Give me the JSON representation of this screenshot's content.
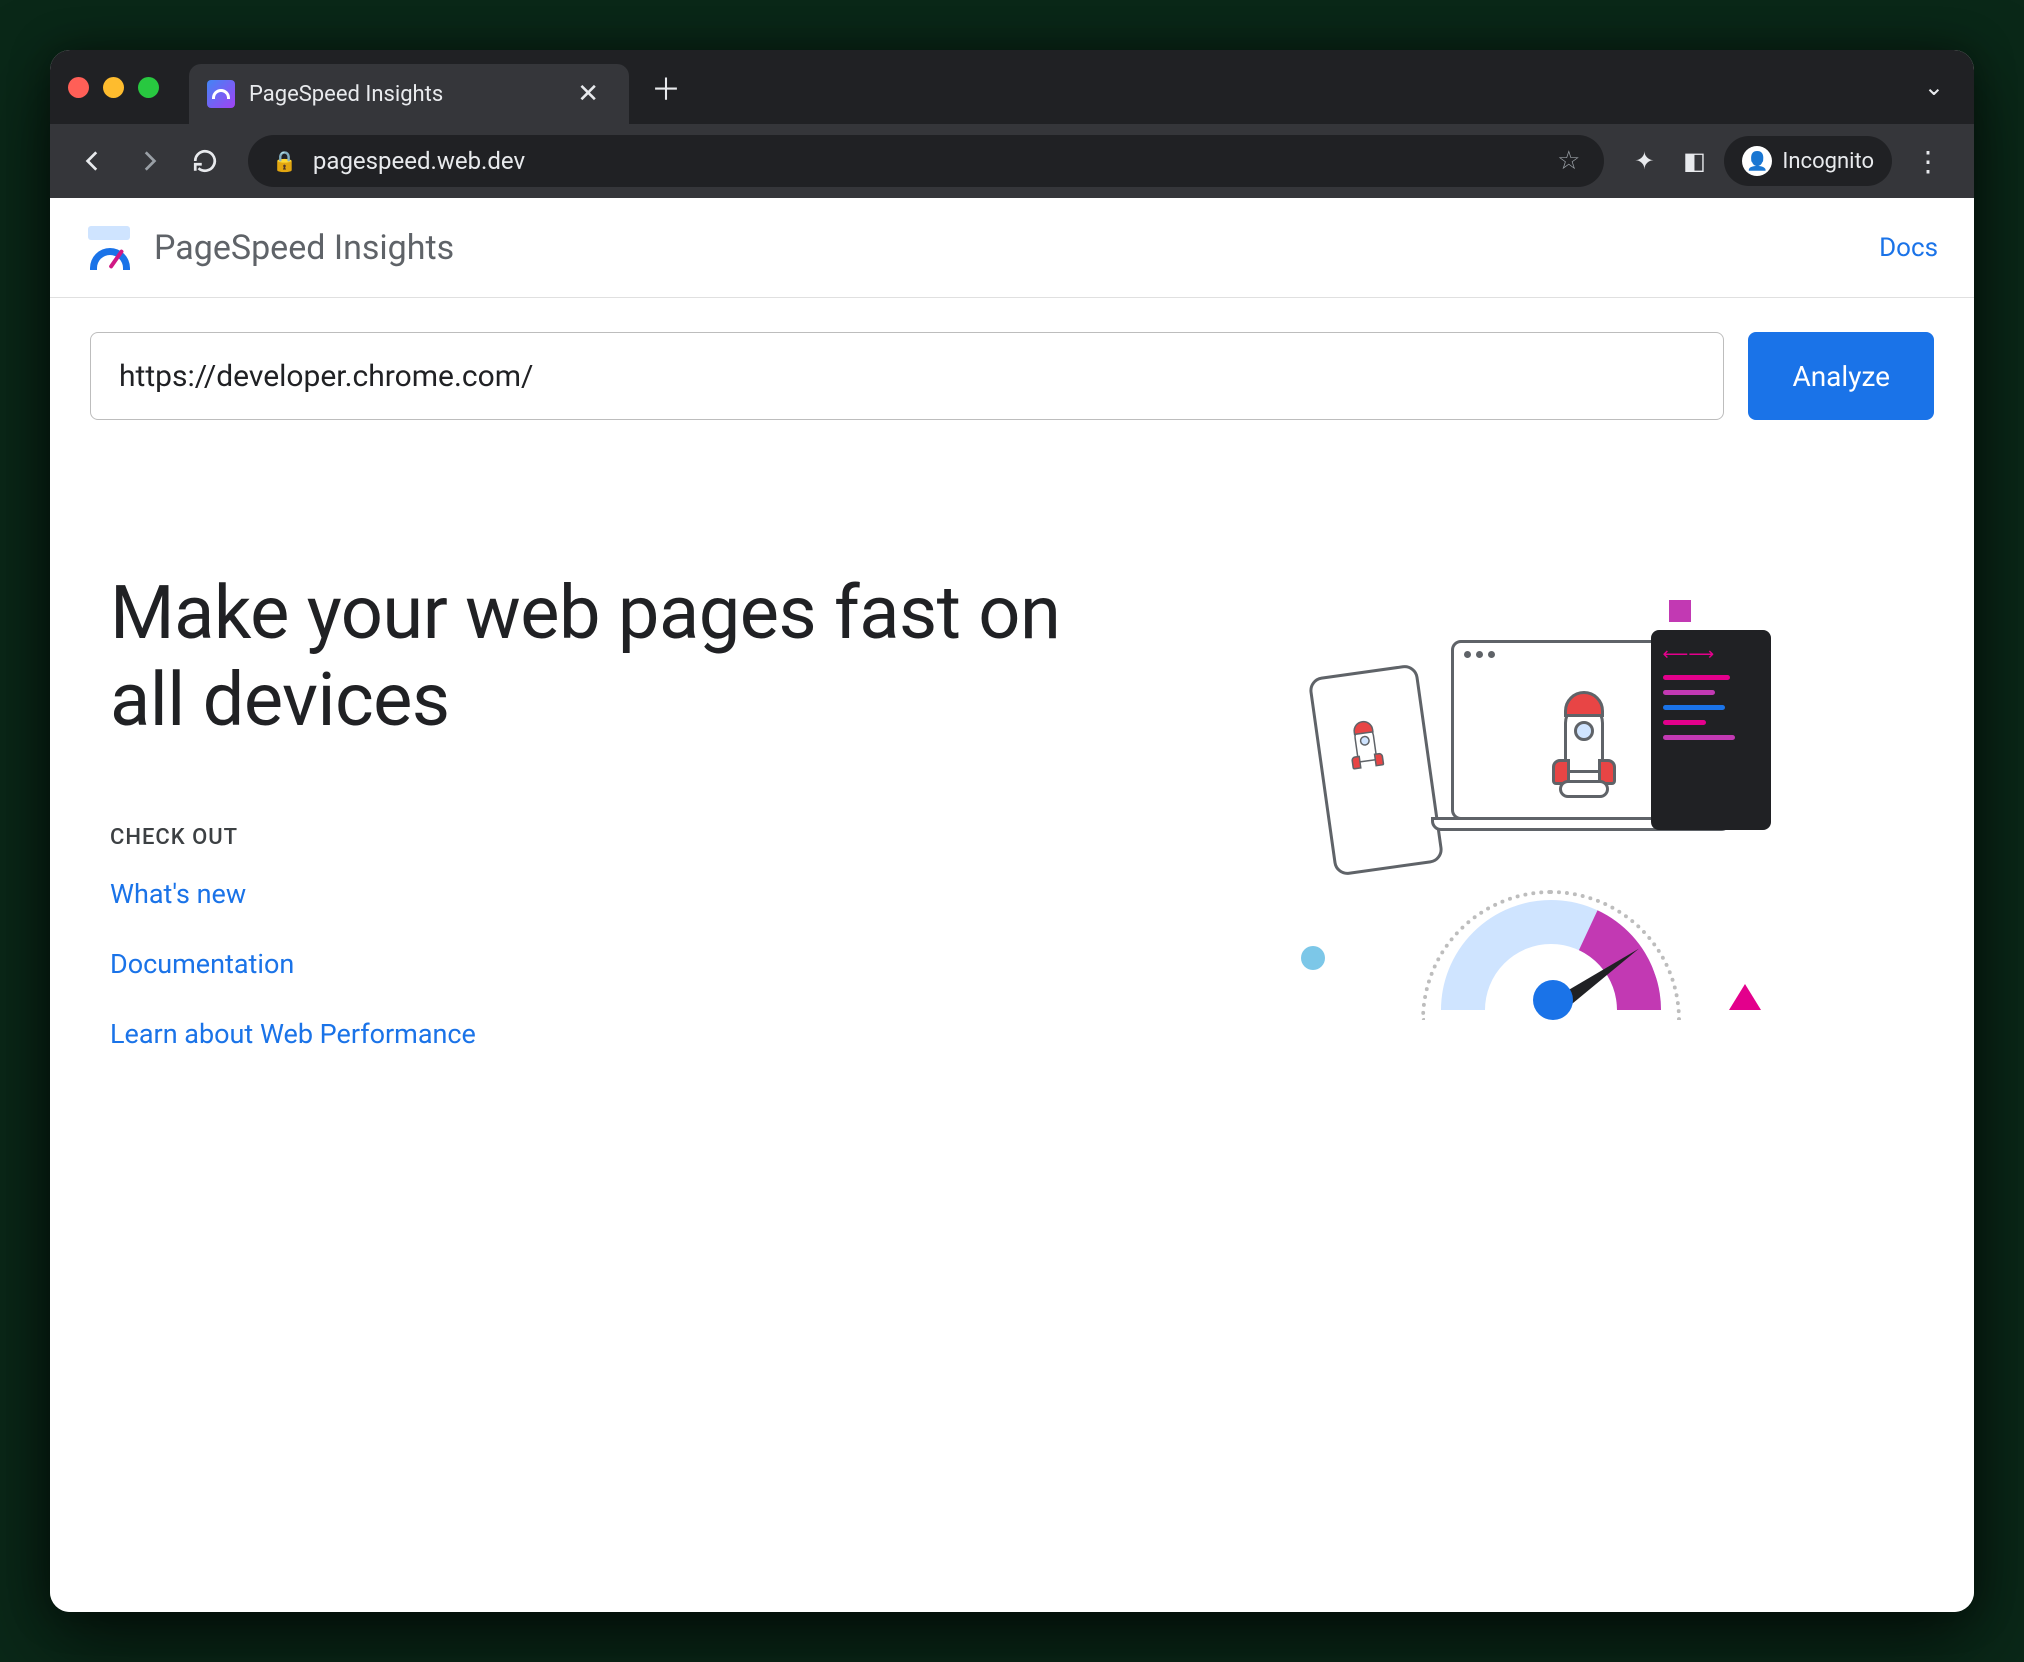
{
  "browser": {
    "tab_title": "PageSpeed Insights",
    "url": "pagespeed.web.dev",
    "incognito_label": "Incognito"
  },
  "header": {
    "product_name": "PageSpeed Insights",
    "docs_link": "Docs"
  },
  "form": {
    "url_value": "https://developer.chrome.com/",
    "analyze_label": "Analyze"
  },
  "hero": {
    "headline": "Make your web pages fast on all devices",
    "checkout_label": "CHECK OUT",
    "links": [
      "What's new",
      "Documentation",
      "Learn about Web Performance"
    ]
  }
}
